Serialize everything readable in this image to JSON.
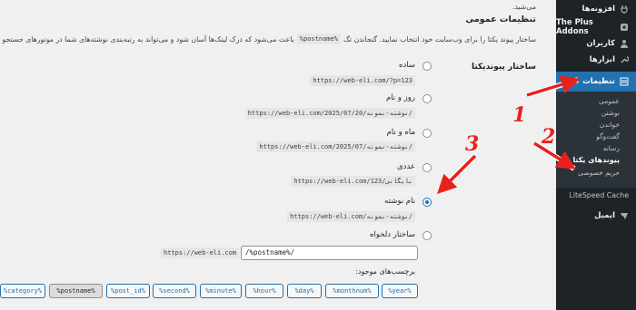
{
  "sidebar": {
    "items": [
      {
        "label": "افزونه‌ها",
        "icon": "plugins-icon"
      },
      {
        "label": "The Plus Addons",
        "icon": "plus-addons-icon"
      },
      {
        "label": "کاربران",
        "icon": "users-icon"
      },
      {
        "label": "ابزارها",
        "icon": "tools-icon"
      },
      {
        "label": "تنظیمات",
        "icon": "settings-icon"
      }
    ],
    "submenu": [
      "عمومی",
      "نوشتن",
      "خواندن",
      "گفت‌وگو",
      "رسانه",
      "پیوندهای یکتا",
      "حریم خصوصی",
      "LiteSpeed Cache"
    ],
    "after": {
      "label": "ایمیل",
      "icon": "email-icon"
    },
    "accent": "#2271b1"
  },
  "main": {
    "top_fragment": "می‌شید.",
    "section_title": "تنظیمات عمومی",
    "intro_before": "ساختار پیوند یکتا را برای وب‌سایت خود انتخاب نمایید. گنجاندن تگ",
    "intro_tag": "%postname%",
    "intro_after": "باعث می‌شود که درک لینک‌ها آسان شود و می‌تواند به رتبه‌بندی نوشته‌های شما در موتورهای جستجو کمک کند.",
    "permalink_label": "ساختار پیوندیکتا",
    "options": [
      {
        "label": "ساده",
        "example": "https://web-eli.com/?p=123"
      },
      {
        "label": "روز و نام",
        "example": "https://web-eli.com/2025/07/20/نوشته-نمونه/"
      },
      {
        "label": "ماه و نام",
        "example": "https://web-eli.com/2025/07/نوشته-نمونه/"
      },
      {
        "label": "عددی",
        "example": "https://web-eli.com/بایگانی/123"
      },
      {
        "label": "نام نوشته",
        "example": "https://web-eli.com/نوشته-نمونه/"
      },
      {
        "label": "ساختار دلخواه",
        "example": ""
      }
    ],
    "selected_option": "نام نوشته",
    "custom_prefix": "https://web-eli.com",
    "custom_value": "/%postname%/",
    "available_tags_label": "برچسب‌های موجود:",
    "tags": [
      "%year%",
      "%monthnum%",
      "%day%",
      "%hour%",
      "%minute%",
      "%second%",
      "%post_id%",
      "%postname%",
      "%category%"
    ],
    "selected_tag": "%postname%"
  },
  "annotations": {
    "n1": "1",
    "n2": "2",
    "n3": "3",
    "color": "#e8221b"
  }
}
